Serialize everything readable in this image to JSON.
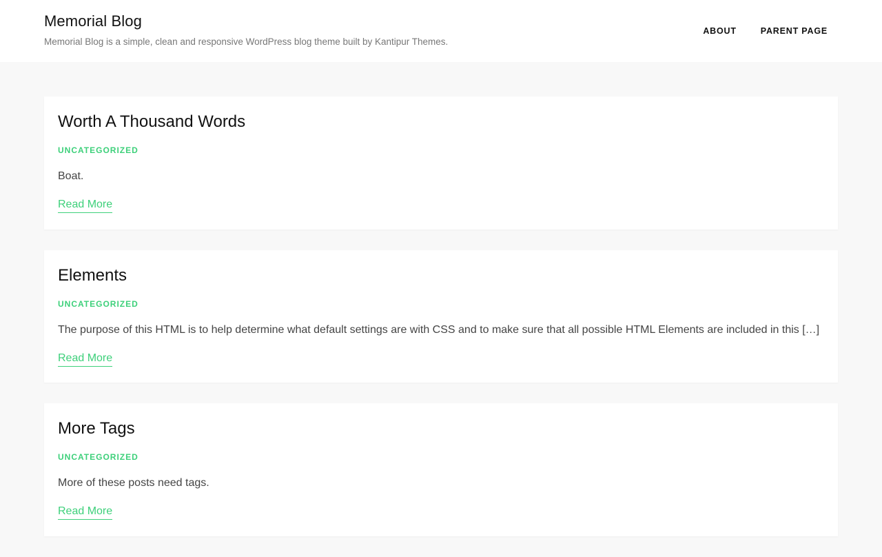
{
  "site": {
    "title": "Memorial Blog",
    "description": "Memorial Blog is a simple, clean and responsive WordPress blog theme built by Kantipur Themes."
  },
  "nav": {
    "items": [
      {
        "label": "ABOUT"
      },
      {
        "label": "PARENT PAGE"
      }
    ]
  },
  "posts": [
    {
      "title": "Worth A Thousand Words",
      "category": "UNCATEGORIZED",
      "excerpt": "Boat.",
      "read_more": "Read More"
    },
    {
      "title": "Elements",
      "category": "UNCATEGORIZED",
      "excerpt": "The purpose of this HTML is to help determine what default settings are with CSS and to make sure that all possible HTML Elements are included in this […]",
      "read_more": "Read More"
    },
    {
      "title": "More Tags",
      "category": "UNCATEGORIZED",
      "excerpt": "More of these posts need tags.",
      "read_more": "Read More"
    }
  ],
  "colors": {
    "accent": "#3dd07a",
    "background": "#f8f8f8",
    "card": "#ffffff"
  }
}
